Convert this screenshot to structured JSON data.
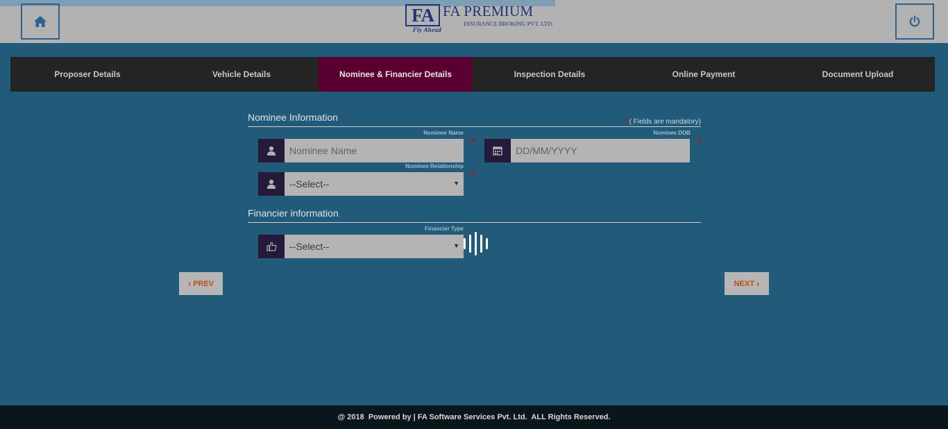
{
  "header": {
    "logo": {
      "mark": "FA",
      "tagline": "Fly Ahead",
      "name": "FA PREMIUM",
      "subtitle": "INSURANCE BROKING PVT. LTD."
    },
    "home_icon": "home-icon",
    "power_icon": "power-icon",
    "progress_percent": 58.6
  },
  "tabs": [
    {
      "label": "Proposer Details",
      "active": false
    },
    {
      "label": "Vehicle Details",
      "active": false
    },
    {
      "label": "Nominee & Financier Details",
      "active": true
    },
    {
      "label": "Inspection Details",
      "active": false
    },
    {
      "label": "Online Payment",
      "active": false
    },
    {
      "label": "Document Upload",
      "active": false
    }
  ],
  "nominee": {
    "section_title": "Nominee Information",
    "mandatory_note": "( Fields are mandatory)",
    "name": {
      "label": "Nominee Name",
      "placeholder": "Nominee Name",
      "value": ""
    },
    "dob": {
      "label": "Nominee DOB",
      "placeholder": "DD/MM/YYYY",
      "value": ""
    },
    "relationship": {
      "label": "Nominee Relationship",
      "selected": "--Select--"
    }
  },
  "financier": {
    "section_title": "Financier information",
    "type": {
      "label": "Financier Type",
      "selected": "--Select--"
    }
  },
  "nav": {
    "prev_label": "PREV",
    "next_label": "NEXT"
  },
  "footer": {
    "text": "@ 2018  Powered by | FA Software Services Pvt. Ltd.  ALL Rights Reserved."
  },
  "colors": {
    "background": "#225a7a",
    "active_tab": "#5a0030",
    "tab_bar": "#242424",
    "icon_box": "#261a3b",
    "accent_orange": "#c4480e",
    "required": "#c01010"
  }
}
